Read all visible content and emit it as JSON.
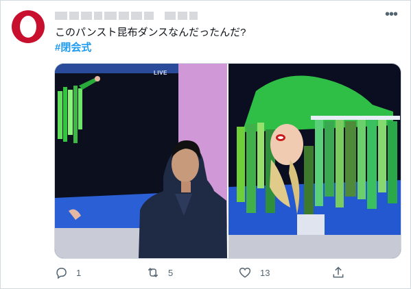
{
  "tweet": {
    "author": {
      "avatar_icon": "opera-logo-icon",
      "avatar_color": "#c8102e"
    },
    "text": "このパンスト昆布ダンスなんだったんだ?",
    "hashtag": "#閉会式",
    "accent_color": "#1d9bf0",
    "media": {
      "photo_left": {
        "badge": "LIVE"
      },
      "photo_right": {}
    },
    "actions": {
      "reply": {
        "icon": "reply-icon",
        "count": "1"
      },
      "retweet": {
        "icon": "retweet-icon",
        "count": "5"
      },
      "like": {
        "icon": "like-icon",
        "count": "13"
      },
      "share": {
        "icon": "share-icon"
      }
    },
    "menu_icon": "more-icon"
  }
}
